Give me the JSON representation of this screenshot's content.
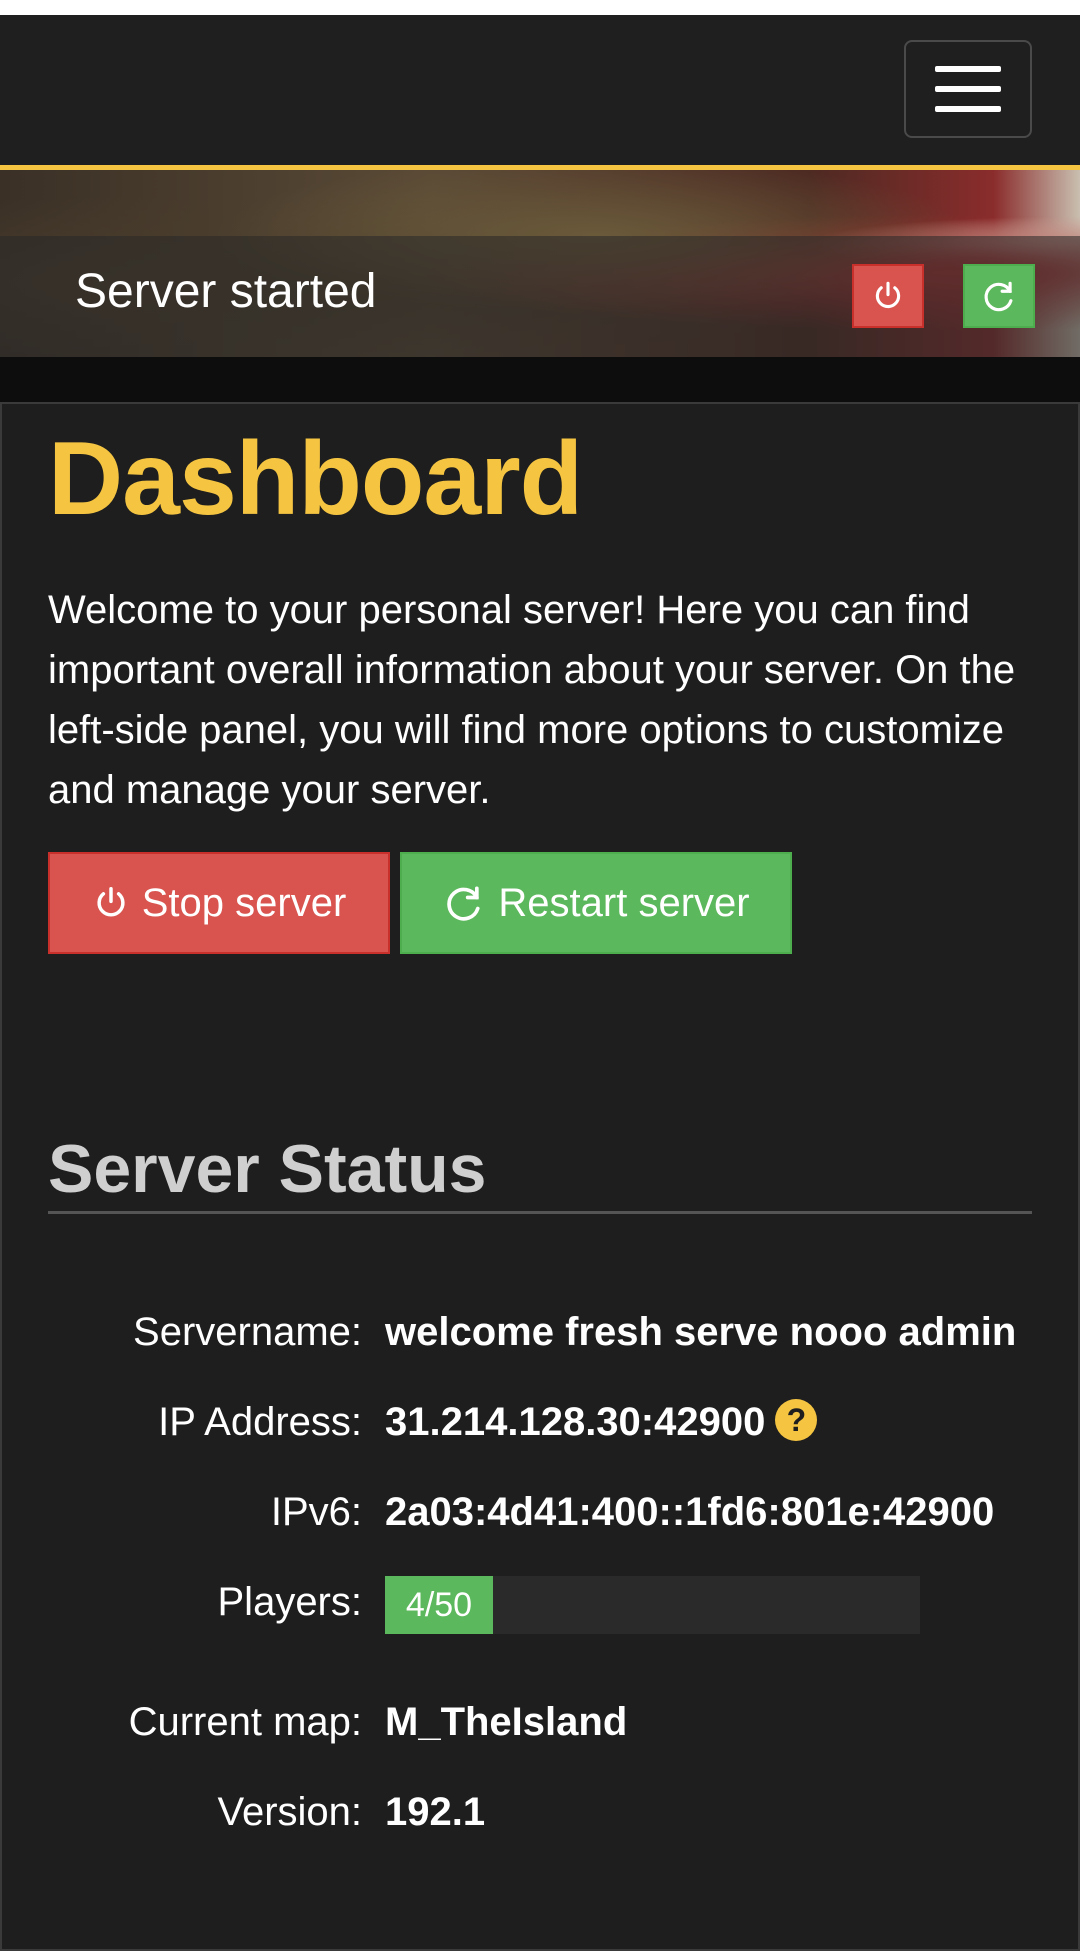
{
  "navbar": {
    "menu_icon": "hamburger-menu-icon"
  },
  "banner": {
    "status_text": "Server started",
    "stop_icon": "power-icon",
    "restart_icon": "refresh-icon",
    "stop_color": "#d9534f",
    "restart_color": "#5cb85c"
  },
  "main": {
    "title": "Dashboard",
    "intro": "Welcome to your personal server! Here you can find important overall information about your server. On the left-side panel, you will find more options to customize and manage your server.",
    "stop_button_label": "Stop server",
    "restart_button_label": "Restart server",
    "accent_color": "#f5c542"
  },
  "status": {
    "heading": "Server Status",
    "servername_label": "Servername:",
    "servername_value": "welcome fresh serve nooo admin",
    "ip_label": "IP Address:",
    "ip_value": "31.214.128.30:42900",
    "ip_help_icon": "question-icon",
    "ipv6_label": "IPv6:",
    "ipv6_value": "2a03:4d41:400::1fd6:801e:42900",
    "players_label": "Players:",
    "players_text": "4/50",
    "players_current": 4,
    "players_max": 50,
    "map_label": "Current map:",
    "map_value": "M_TheIsland",
    "version_label": "Version:",
    "version_value": "192.1"
  }
}
